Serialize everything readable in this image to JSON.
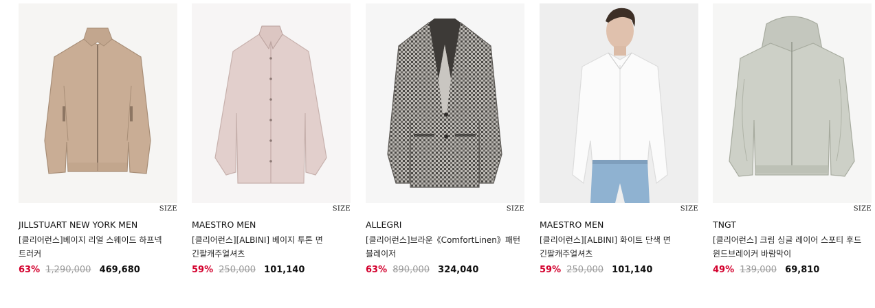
{
  "products": [
    {
      "brand": "JILLSTUART NEW YORK MEN",
      "name": "[클리어런스]베이지 리얼 스웨이드 하프넥 트러커",
      "size_label": "SIZE",
      "discount": "63%",
      "original_price": "1,290,000",
      "final_price": "469,680",
      "image": "beige-suede-jacket"
    },
    {
      "brand": "MAESTRO MEN",
      "name": "[클리어런스][ALBINI] 베이지 투톤 면 긴팔캐주얼셔츠",
      "size_label": "SIZE",
      "discount": "59%",
      "original_price": "250,000",
      "final_price": "101,140",
      "image": "beige-shirt"
    },
    {
      "brand": "ALLEGRI",
      "name": "[클리어런스]브라운《ComfortLinen》패턴 블레이저",
      "size_label": "SIZE",
      "discount": "63%",
      "original_price": "890,000",
      "final_price": "324,040",
      "image": "houndstooth-blazer"
    },
    {
      "brand": "MAESTRO MEN",
      "name": "[클리어런스][ALBINI] 화이트 단색 면 긴팔캐주얼셔츠",
      "size_label": "SIZE",
      "discount": "59%",
      "original_price": "250,000",
      "final_price": "101,140",
      "image": "model-white-shirt"
    },
    {
      "brand": "TNGT",
      "name": "[클리어런스] 크림 싱글 레이어 스포티 후드 윈드브레이커 바람막이",
      "size_label": "SIZE",
      "discount": "49%",
      "original_price": "139,000",
      "final_price": "69,810",
      "image": "cream-hooded-windbreaker"
    }
  ],
  "colors": {
    "discount": "#d3002d",
    "original_price": "#9a9a9a",
    "text": "#111111"
  }
}
